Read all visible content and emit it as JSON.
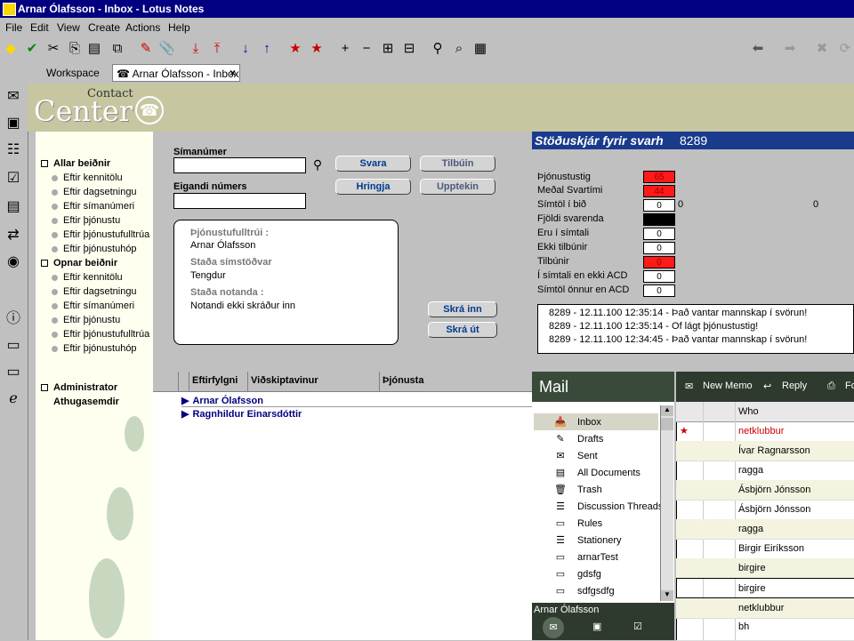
{
  "window": {
    "title": "Arnar Ólafsson - Inbox - Lotus Notes"
  },
  "menu": [
    "File",
    "Edit",
    "View",
    "Create",
    "Actions",
    "Help"
  ],
  "tabs": {
    "workspace": "Workspace",
    "inbox": "Arnar Ólafsson - Inbox",
    "close": "×"
  },
  "logo": {
    "contact": "Contact",
    "center": "Center"
  },
  "nav": {
    "group1": "Allar beiðnir",
    "group1_items": [
      "Eftir kennitölu",
      "Eftir dagsetningu",
      "Eftir símanúmeri",
      "Eftir þjónustu",
      "Eftir þjónustufulltrúa",
      "Eftir þjónustuhóp"
    ],
    "group2": "Opnar beiðnir",
    "group2_items": [
      "Eftir kennitölu",
      "Eftir dagsetningu",
      "Eftir símanúmeri",
      "Eftir þjónustu",
      "Eftir þjónustufulltrúa",
      "Eftir þjónustuhóp"
    ],
    "group3_line1": "Administrator",
    "group3_line2": "Athugasemdir"
  },
  "form": {
    "phone_label": "Símanúmer",
    "phone_value": "",
    "owner_label": "Eigandi númers",
    "owner_value": "",
    "btn_answer": "Svara",
    "btn_ready": "Tilbúin",
    "btn_call": "Hringja",
    "btn_busy": "Upptekin",
    "btn_login": "Skrá inn",
    "btn_logout": "Skrá út"
  },
  "info": {
    "agent_label": "Þjónustufulltrúi :",
    "agent_value": "Arnar Ólafsson",
    "station_label": "Staða símstöðvar",
    "station_value": "Tengdur",
    "user_label": "Staða notanda :",
    "user_value": "Notandi ekki skráður inn"
  },
  "status": {
    "title": "Stöðuskjár fyrir svarh",
    "title_num": "8289",
    "rows": [
      {
        "label": "Þjónustustig",
        "value": "65",
        "style": "red"
      },
      {
        "label": "Meðal Svartími",
        "value": "44",
        "style": "red"
      },
      {
        "label": "Símtöl í bið",
        "value": "0",
        "style": "white",
        "extra1": "0",
        "extra2": "0"
      },
      {
        "label": "Fjöldi svarenda",
        "value": "",
        "style": "black"
      },
      {
        "label": "Eru í símtali",
        "value": "0",
        "style": "white"
      },
      {
        "label": "Ekki tilbúnir",
        "value": "0",
        "style": "white"
      },
      {
        "label": "Tilbúnir",
        "value": "0",
        "style": "red"
      },
      {
        "label": "Í símtali en ekki ACD",
        "value": "0",
        "style": "white"
      },
      {
        "label": "Símtöl önnur en ACD",
        "value": "0",
        "style": "white"
      }
    ],
    "log": [
      "8289 - 12.11.100 12:35:14 - Það vantar mannskap í svörun!",
      "8289 - 12.11.100 12:35:14 - Of lágt þjónustustig!",
      "8289 - 12.11.100 12:34:45 - Það vantar mannskap í svörun!"
    ]
  },
  "view": {
    "columns": [
      "Eftirfylgni",
      "Viðskiptavinur",
      "Þjónusta"
    ],
    "rows": [
      "Arnar Ólafsson",
      "Ragnhildur Einarsdóttir"
    ]
  },
  "mail": {
    "title": "Mail",
    "folders": [
      "Inbox",
      "Drafts",
      "Sent",
      "All Documents",
      "Trash",
      "Discussion Threads",
      "Rules",
      "Stationery",
      "arnarTest",
      "gdsfg",
      "sdfgsdfg"
    ],
    "owner": "Arnar Ólafsson"
  },
  "messages": {
    "tools": {
      "new_memo": "New Memo",
      "reply": "Reply",
      "forward": "Fo"
    },
    "who_header": "Who",
    "rows": [
      "netklubbur",
      "Ívar Ragnarsson",
      "ragga",
      "Ásbjörn Jónsson",
      "Ásbjörn Jónsson",
      "ragga",
      "Birgir Eiríksson",
      "birgire",
      "birgire",
      "netklubbur",
      "bh"
    ]
  }
}
